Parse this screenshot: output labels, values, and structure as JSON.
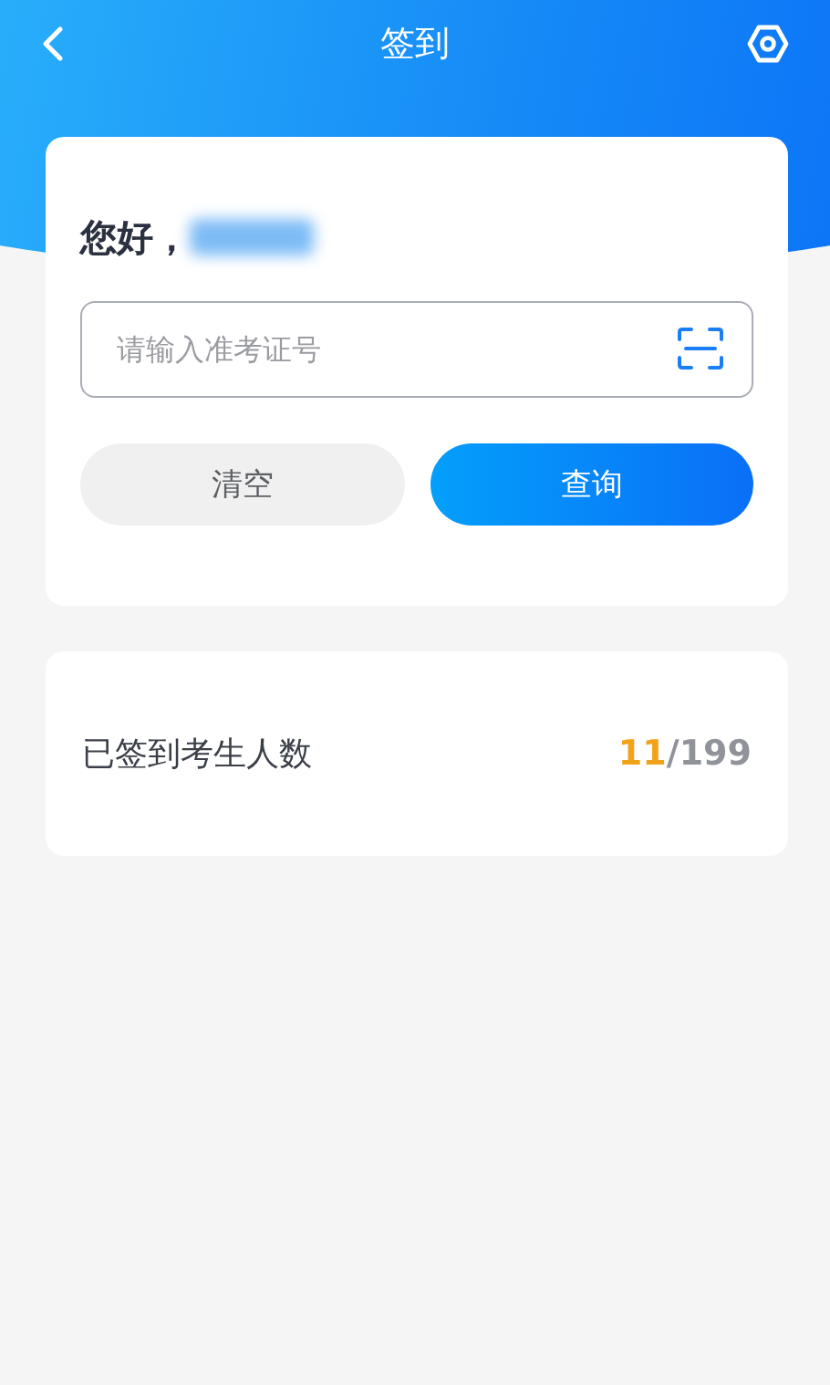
{
  "nav": {
    "title": "签到"
  },
  "greeting": {
    "text": "您好，"
  },
  "search": {
    "placeholder": "请输入准考证号"
  },
  "buttons": [
    {
      "label": "清空",
      "kind": "secondary"
    },
    {
      "label": "查询",
      "kind": "primary"
    }
  ],
  "stats": {
    "label": "已签到考生人数",
    "signed": "11",
    "separator": "/",
    "total": "199"
  }
}
